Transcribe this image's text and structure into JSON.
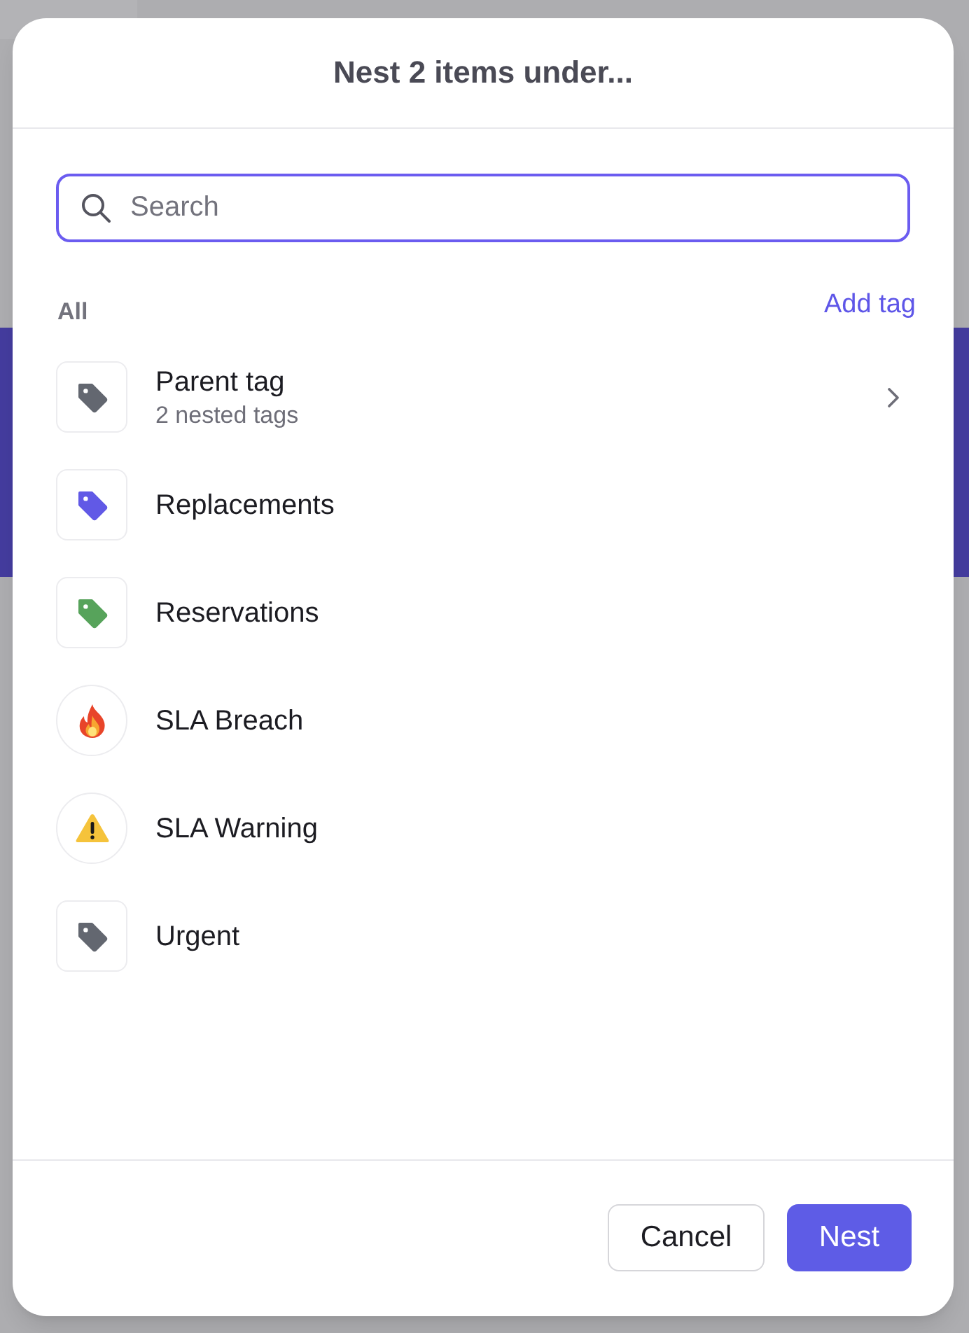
{
  "dialog": {
    "title": "Nest 2 items under..."
  },
  "search": {
    "placeholder": "Search"
  },
  "list_header": {
    "label": "All",
    "action": "Add tag"
  },
  "items": [
    {
      "kind": "tag",
      "color": "#636770",
      "label": "Parent tag",
      "subtitle": "2 nested tags",
      "expandable": true
    },
    {
      "kind": "tag",
      "color": "#6159e6",
      "label": "Replacements",
      "expandable": false
    },
    {
      "kind": "tag",
      "color": "#57a35b",
      "label": "Reservations",
      "expandable": false
    },
    {
      "kind": "fire",
      "label": "SLA Breach",
      "expandable": false
    },
    {
      "kind": "warning",
      "label": "SLA Warning",
      "expandable": false
    },
    {
      "kind": "tag",
      "color": "#636770",
      "label": "Urgent",
      "expandable": false
    }
  ],
  "buttons": [
    {
      "label": "Cancel",
      "kind": "secondary"
    },
    {
      "label": "Nest",
      "kind": "primary"
    }
  ]
}
